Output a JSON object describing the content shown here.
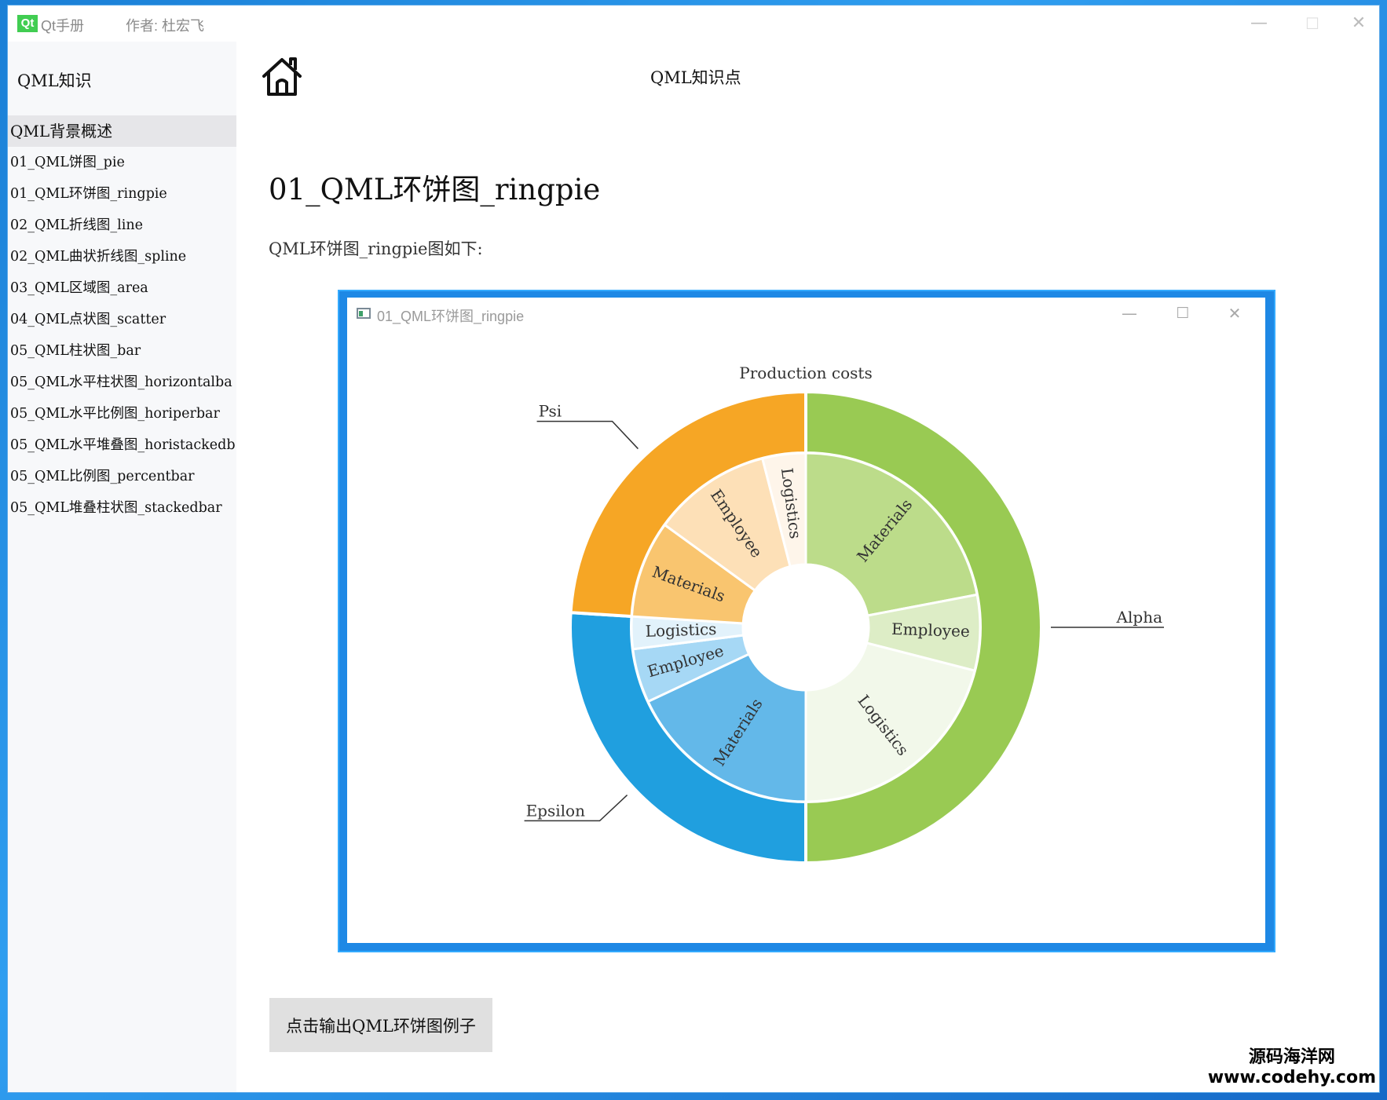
{
  "window": {
    "logo_text": "Qt",
    "app_title": "Qt手册",
    "author": "作者: 杜宏飞",
    "minimize": "—",
    "maximize": "☐",
    "close": "✕"
  },
  "sidebar": {
    "title": "QML知识",
    "items": [
      {
        "label": "QML背景概述"
      },
      {
        "label": "01_QML饼图_pie"
      },
      {
        "label": "01_QML环饼图_ringpie"
      },
      {
        "label": "02_QML折线图_line"
      },
      {
        "label": "02_QML曲状折线图_spline"
      },
      {
        "label": "03_QML区域图_area"
      },
      {
        "label": "04_QML点状图_scatter"
      },
      {
        "label": "05_QML柱状图_bar"
      },
      {
        "label": "05_QML水平柱状图_horizontalba"
      },
      {
        "label": "05_QML水平比例图_horiperbar"
      },
      {
        "label": "05_QML水平堆叠图_horistackedb"
      },
      {
        "label": "05_QML比例图_percentbar"
      },
      {
        "label": "05_QML堆叠柱状图_stackedbar"
      }
    ]
  },
  "header": {
    "home_icon": "home-icon",
    "title": "QML知识点"
  },
  "main": {
    "page_title": "01_QML环饼图_ringpie",
    "description": "QML环饼图_ringpie图如下:",
    "button_label": "点击输出QML环饼图例子"
  },
  "demo_window": {
    "title": "01_QML环饼图_ringpie",
    "minimize": "—",
    "maximize": "☐",
    "close": "✕"
  },
  "chart_data": {
    "type": "pie",
    "title": "Production costs",
    "series": [
      {
        "name": "Alpha",
        "color": "#99ca53",
        "value": 50,
        "slices": [
          {
            "label": "Materials",
            "value": 22,
            "color": "#bcdc8a"
          },
          {
            "label": "Employee",
            "value": 7,
            "color": "#ddedc6"
          },
          {
            "label": "Logistics",
            "value": 21,
            "color": "#f2f8ea"
          }
        ]
      },
      {
        "name": "Epsilon",
        "color": "#209fdf",
        "value": 26,
        "slices": [
          {
            "label": "Materials",
            "value": 18,
            "color": "#63b8e9"
          },
          {
            "label": "Employee",
            "value": 5,
            "color": "#a6d8f5"
          },
          {
            "label": "Logistics",
            "value": 3,
            "color": "#e2f2fb"
          }
        ]
      },
      {
        "name": "Psi",
        "color": "#f6a625",
        "value": 24,
        "slices": [
          {
            "label": "Materials",
            "value": 9,
            "color": "#f9c56f"
          },
          {
            "label": "Employee",
            "value": 11,
            "color": "#fde0b7"
          },
          {
            "label": "Logistics",
            "value": 4,
            "color": "#fef5ea"
          }
        ]
      }
    ]
  },
  "watermark": {
    "line1": "源码海洋网",
    "line2": "www.codehy.com"
  }
}
